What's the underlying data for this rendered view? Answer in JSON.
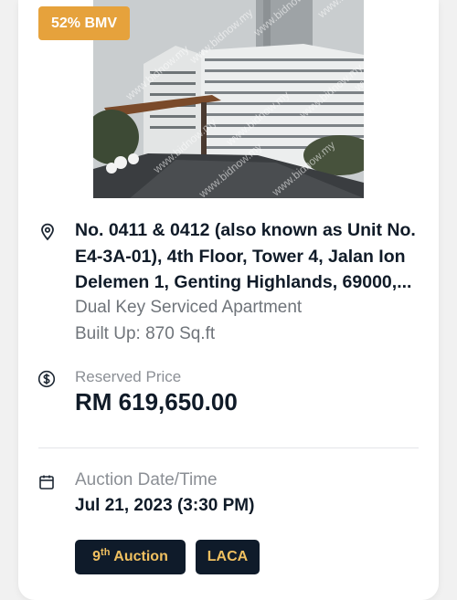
{
  "listing": {
    "badge": "52% BMV",
    "address_lines": [
      "No. 0411 & 0412 (also known as Unit No.",
      "E4-3A-01), 4th Floor, Tower 4, Jalan Ion",
      "Delemen 1, Genting Highlands, 69000,..."
    ],
    "property_type": "Dual Key Serviced Apartment",
    "built_up": "Built Up: 870 Sq.ft",
    "reserved_price_label": "Reserved Price",
    "reserved_price": "RM 619,650.00",
    "auction_label": "Auction Date/Time",
    "auction_datetime": "Jul 21, 2023 (3:30 PM)",
    "auction_round_number": "9",
    "auction_round_suffix": "th",
    "auction_round_word": "Auction",
    "tag_laca": "LACA",
    "watermark": "www.bidnow.my"
  },
  "colors": {
    "badge": "#e6a23c",
    "tag_bg": "#0f1b2a",
    "tag_text": "#f0c060",
    "title": "#101b28",
    "muted": "#6f747a"
  },
  "icons": {
    "address": "map-pin-icon",
    "price": "dollar-circle-icon",
    "date": "calendar-icon"
  }
}
